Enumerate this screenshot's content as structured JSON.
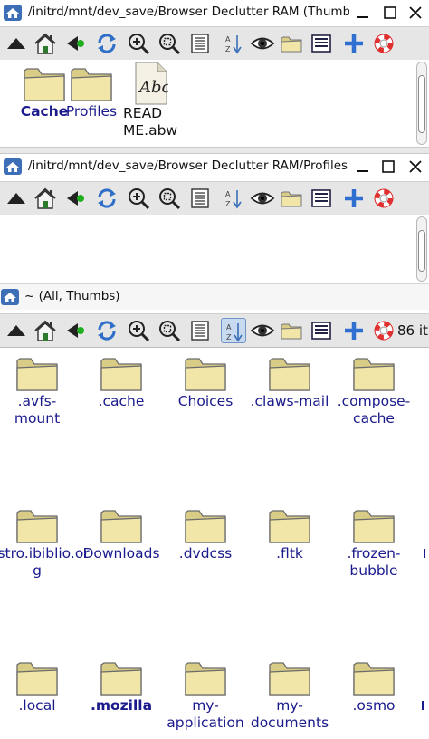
{
  "windows": [
    {
      "title": "/initrd/mnt/dev_save/Browser Declutter RAM (Thumbs",
      "items": [
        {
          "label": "Cache",
          "type": "folder",
          "bold": true
        },
        {
          "label": "Profiles",
          "type": "folder",
          "bold": false
        },
        {
          "label": "READ ME.abw",
          "type": "abw-document",
          "bold": false
        }
      ]
    },
    {
      "title": "/initrd/mnt/dev_save/Browser Declutter RAM/Profiles (",
      "items": []
    },
    {
      "title": "~ (All, Thumbs)",
      "item_count": "86 it",
      "items": [
        {
          "label": ".avfs-mount",
          "type": "folder",
          "bold": false
        },
        {
          "label": ".cache",
          "type": "folder",
          "bold": false
        },
        {
          "label": "Choices",
          "type": "folder",
          "bold": false
        },
        {
          "label": ".claws-mail",
          "type": "folder",
          "bold": false
        },
        {
          "label": ".compose-cache",
          "type": "folder",
          "bold": false
        },
        {
          "label": "distro.ibiblio.org",
          "type": "folder",
          "bold": false
        },
        {
          "label": "Downloads",
          "type": "folder",
          "bold": false
        },
        {
          "label": ".dvdcss",
          "type": "folder",
          "bold": false
        },
        {
          "label": ".fltk",
          "type": "folder",
          "bold": false
        },
        {
          "label": ".frozen-bubble",
          "type": "folder",
          "bold": false
        },
        {
          "label": ".local",
          "type": "folder",
          "bold": false
        },
        {
          "label": ".mozilla",
          "type": "folder",
          "bold": true
        },
        {
          "label": "my-application",
          "type": "folder",
          "bold": false
        },
        {
          "label": "my-documents",
          "type": "folder",
          "bold": false
        },
        {
          "label": ".osmo",
          "type": "folder",
          "bold": false
        }
      ]
    }
  ],
  "toolbar": [
    {
      "name": "up-arrow-icon",
      "tooltip": "Up"
    },
    {
      "name": "home-icon",
      "tooltip": "Home"
    },
    {
      "name": "back-icon",
      "tooltip": "Back"
    },
    {
      "name": "refresh-icon",
      "tooltip": "Refresh"
    },
    {
      "name": "zoom-in-icon",
      "tooltip": "Zoom in"
    },
    {
      "name": "zoom-fit-icon",
      "tooltip": "Zoom"
    },
    {
      "name": "details-icon",
      "tooltip": "Details"
    },
    {
      "name": "sort-icon",
      "tooltip": "Sort"
    },
    {
      "name": "eye-icon",
      "tooltip": "Show hidden"
    },
    {
      "name": "folder-icon",
      "tooltip": "Select"
    },
    {
      "name": "list-icon",
      "tooltip": "Options"
    },
    {
      "name": "plus-icon",
      "tooltip": "New"
    },
    {
      "name": "help-icon",
      "tooltip": "Help"
    }
  ],
  "colors": {
    "label_text": "#1a1a8c",
    "toolbar_bg": "#e6e6e6",
    "folder_fill": "#f1e6a8",
    "folder_stroke": "#6b6b6b"
  }
}
